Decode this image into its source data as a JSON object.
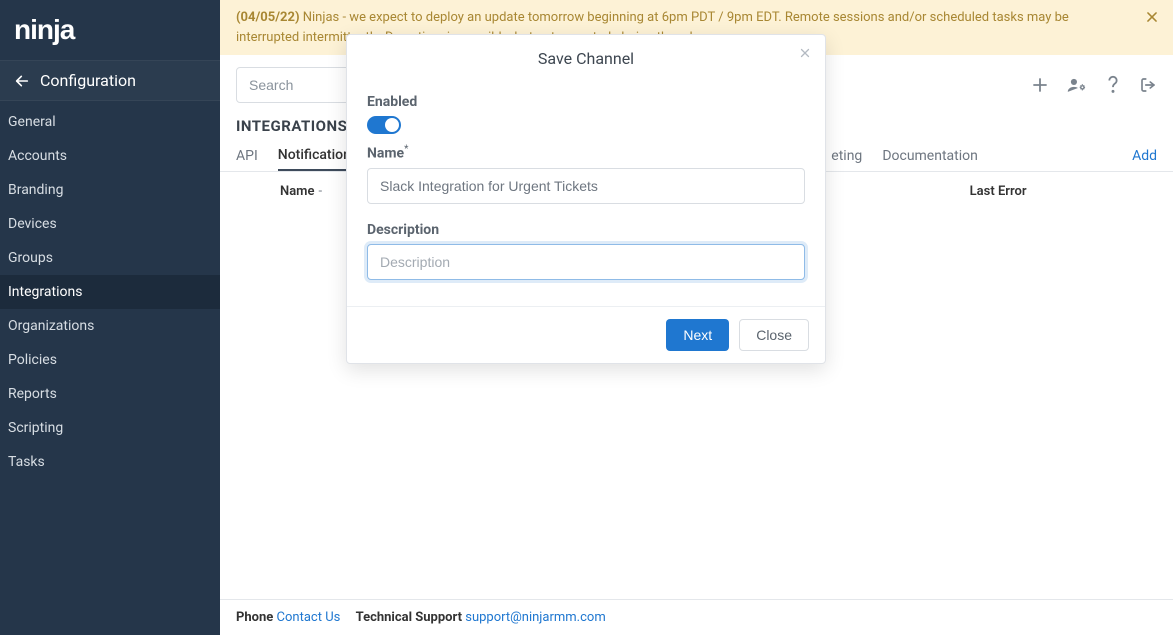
{
  "logo": "ninja",
  "sidebar": {
    "header": "Configuration",
    "items": [
      {
        "label": "General",
        "active": false
      },
      {
        "label": "Accounts",
        "active": false
      },
      {
        "label": "Branding",
        "active": false
      },
      {
        "label": "Devices",
        "active": false
      },
      {
        "label": "Groups",
        "active": false
      },
      {
        "label": "Integrations",
        "active": true
      },
      {
        "label": "Organizations",
        "active": false
      },
      {
        "label": "Policies",
        "active": false
      },
      {
        "label": "Reports",
        "active": false
      },
      {
        "label": "Scripting",
        "active": false
      },
      {
        "label": "Tasks",
        "active": false
      }
    ]
  },
  "banner": {
    "date": "(04/05/22)",
    "text": "Ninjas - we expect to deploy an update tomorrow beginning at 6pm PDT / 9pm EDT. Remote sessions and/or scheduled tasks may be interrupted intermittently. Downtime is possible, but not expected, during the release."
  },
  "search": {
    "placeholder": "Search"
  },
  "section": {
    "title": "INTEGRATIONS"
  },
  "tabs": {
    "items": [
      {
        "label": "API",
        "active": false
      },
      {
        "label": "Notification Channels",
        "active": true,
        "truncated": "Notification Ch"
      },
      {
        "label": "eting",
        "active": false
      },
      {
        "label": "Documentation",
        "active": false
      }
    ],
    "add": "Add"
  },
  "table": {
    "columns": [
      {
        "label": "Name",
        "sort": "-"
      },
      {
        "label": "Last Error"
      }
    ]
  },
  "footer": {
    "phone_label": "Phone",
    "phone_link": "Contact Us",
    "support_label": "Technical Support",
    "support_link": "support@ninjarmm.com"
  },
  "modal": {
    "title": "Save Channel",
    "enabled_label": "Enabled",
    "enabled_value": true,
    "name_label": "Name",
    "name_value": "Slack Integration for Urgent Tickets",
    "desc_label": "Description",
    "desc_placeholder": "Description",
    "desc_value": "",
    "next": "Next",
    "close": "Close"
  }
}
